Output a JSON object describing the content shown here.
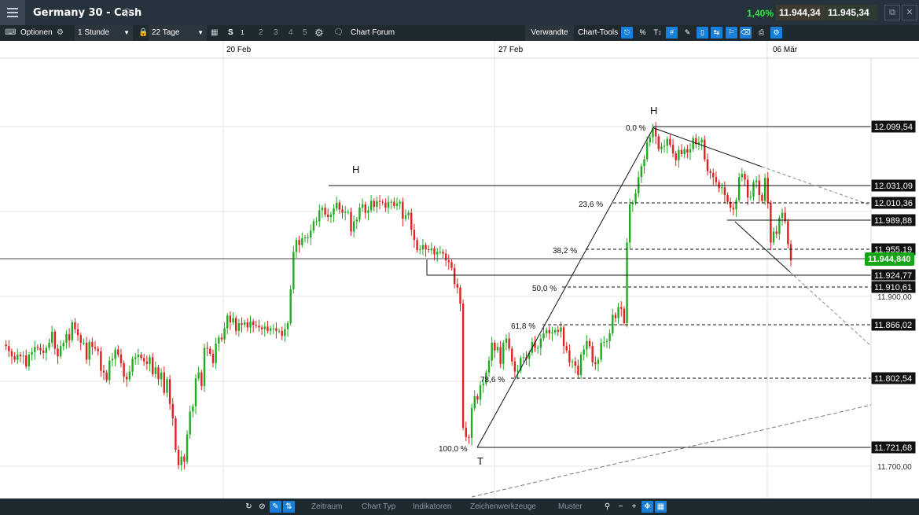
{
  "header": {
    "title": "Germany 30 - Cash",
    "change": "1,40%",
    "bid": "11.944,34",
    "ask": "11.945,34"
  },
  "toolbar": {
    "options_label": "Optionen",
    "interval": "1 Stunde",
    "range": "22 Tage",
    "s_label": "S",
    "s_superscript": "1",
    "tabs": [
      "2",
      "3",
      "4",
      "5"
    ],
    "forum_label": "Chart Forum",
    "related_label": "Verwandte",
    "chart_tools_label": "Chart-Tools",
    "percent_label": "%"
  },
  "bottom": {
    "items": [
      "Zeitraum",
      "Chart Typ",
      "Indikatoren",
      "Zeichenwerkzeuge",
      "Muster"
    ]
  },
  "colors": {
    "up": "#22aa22",
    "down": "#dd2222",
    "current": "#16a516"
  },
  "chart_data": {
    "type": "candlestick",
    "x_labels": [
      "20 Feb",
      "27 Feb",
      "06 Mär"
    ],
    "y_ticks": [
      "11.900,00",
      "11.700,00"
    ],
    "price_labels": [
      "12.099,54",
      "12.031,09",
      "12.010,36",
      "11.989,88",
      "11.955,19",
      "11.924,77",
      "11.910,61",
      "11.866,02",
      "11.802,54",
      "11.721,68"
    ],
    "current_price": "11.944,840",
    "fib_levels": [
      "0,0 %",
      "23,6 %",
      "38,2 %",
      "50,0 %",
      "61,8 %",
      "78,6 %",
      "100,0 %"
    ],
    "pattern_labels": [
      "H",
      "H",
      "T"
    ],
    "series": [
      {
        "values": [
          11843,
          11841,
          11835,
          11829,
          11825,
          11831,
          11829,
          11830,
          11817,
          11831,
          11834,
          11840,
          11839,
          11836,
          11833,
          11839,
          11845,
          11858,
          11838,
          11829,
          11841,
          11845,
          11855,
          11848,
          11869,
          11861,
          11854,
          11845,
          11845,
          11825,
          11846,
          11840,
          11838,
          11835,
          11812,
          11810,
          11801,
          11824,
          11826,
          11837,
          11831,
          11821,
          11805,
          11802,
          11811,
          11826,
          11828,
          11831,
          11827,
          11823,
          11820,
          11828,
          11808,
          11816,
          11802,
          11810,
          11786,
          11802,
          11773,
          11756,
          11719,
          11701,
          11711,
          11705,
          11737,
          11764,
          11770,
          11803,
          11810,
          11794,
          11839,
          11838,
          11832,
          11821,
          11844,
          11851,
          11849,
          11862,
          11877,
          11869,
          11874,
          11859,
          11868,
          11866,
          11869,
          11863,
          11870,
          11866,
          11865,
          11863,
          11861,
          11864,
          11859,
          11862,
          11862,
          11859,
          11859,
          11853,
          11861,
          11868,
          11908,
          11952,
          11966,
          11960,
          11968,
          11969,
          11969,
          11977,
          11988,
          11988,
          12001,
          12004,
          11996,
          11993,
          11996,
          12003,
          12010,
          12002,
          11998,
          11999,
          11999,
          11976,
          11988,
          11990,
          12004,
          12008,
          11998,
          12001,
          12012,
          12005,
          12012,
          12011,
          12010,
          12004,
          12011,
          12011,
          12006,
          12009,
          12011,
          11991,
          11995,
          11998,
          11978,
          11966,
          11954,
          11955,
          11960,
          11955,
          11954,
          11956,
          11949,
          11952,
          11952,
          11950,
          11942,
          11940,
          11933,
          11914,
          11910,
          11891,
          11745,
          11734,
          11733,
          11768,
          11782,
          11778,
          11795,
          11797,
          11810,
          11824,
          11845,
          11836,
          11840,
          11820,
          11845,
          11850,
          11838,
          11823,
          11811,
          11812,
          11827,
          11828,
          11826,
          11833,
          11846,
          11839,
          11839,
          11850,
          11856,
          11860,
          11856,
          11857,
          11860,
          11858,
          11863,
          11841,
          11836,
          11822,
          11823,
          11818,
          11807,
          11831,
          11837,
          11847,
          11841,
          11822,
          11820,
          11825,
          11845,
          11846,
          11847,
          11856,
          11878,
          11874,
          11887,
          11885,
          11868,
          11963,
          12008,
          12010,
          12021,
          12040,
          12053,
          12061,
          12081,
          12087,
          12098,
          12088,
          12073,
          12076,
          12077,
          12085,
          12078,
          12068,
          12060,
          12072,
          12067,
          12073,
          12069,
          12073,
          12086,
          12079,
          12081,
          12084,
          12061,
          12047,
          12045,
          12040,
          12034,
          12027,
          12028,
          12019,
          12011,
          12004,
          12002,
          12013,
          12040,
          12044,
          12037,
          12016,
          12017,
          12034,
          12036,
          12019,
          12012,
          12039,
          12010,
          11963,
          11976,
          11973,
          11992,
          11998,
          11988,
          11961,
          11942
        ]
      }
    ]
  }
}
